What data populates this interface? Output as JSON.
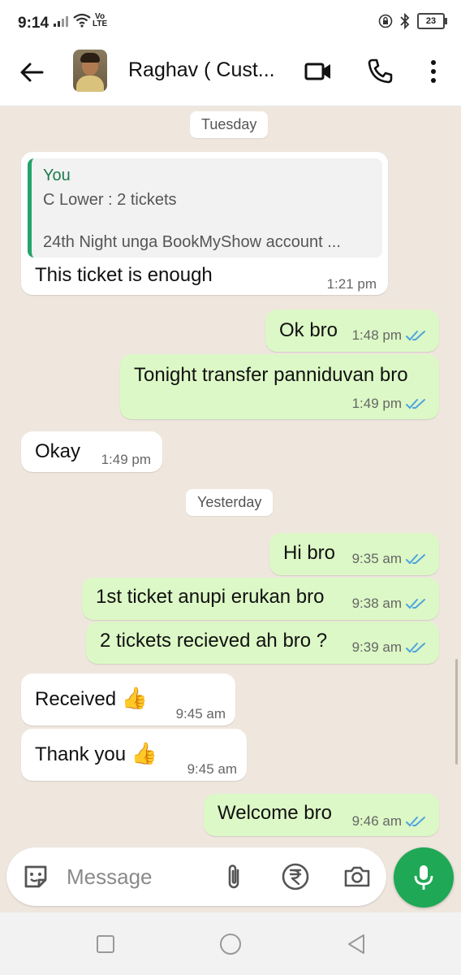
{
  "status_bar": {
    "time": "9:14",
    "network_label_top": "Vo",
    "network_label_bottom": "LTE",
    "battery_level": "23"
  },
  "header": {
    "contact_name": "Raghav ( Cust...",
    "icons": [
      "back-arrow-icon",
      "video-call-icon",
      "phone-icon",
      "more-vert-icon"
    ]
  },
  "chat": {
    "dates": {
      "tuesday": "Tuesday",
      "yesterday": "Yesterday"
    },
    "reply": {
      "quote_author": "You",
      "quote_line1": "C Lower : 2 tickets",
      "quote_line2": "24th Night unga BookMyShow account ...",
      "text": "This ticket is enough",
      "time": "1:21 pm"
    },
    "messages": [
      {
        "direction": "out",
        "text": "Ok bro",
        "time": "1:48 pm",
        "status": "read"
      },
      {
        "direction": "out",
        "text": "Tonight transfer panniduvan bro",
        "time": "1:49 pm",
        "status": "read"
      },
      {
        "direction": "in",
        "text": "Okay",
        "time": "1:49 pm"
      },
      {
        "direction": "out",
        "text": "Hi bro",
        "time": "9:35 am",
        "status": "read"
      },
      {
        "direction": "out",
        "text": "1st ticket anupi erukan bro",
        "time": "9:38 am",
        "status": "read"
      },
      {
        "direction": "out",
        "text": "2 tickets recieved ah bro ?",
        "time": "9:39 am",
        "status": "read"
      },
      {
        "direction": "in",
        "text": "Received",
        "emoji": "👍",
        "time": "9:45 am"
      },
      {
        "direction": "in",
        "text": "Thank you",
        "emoji": "👍",
        "time": "9:45 am"
      },
      {
        "direction": "out",
        "text": "Welcome bro",
        "time": "9:46 am",
        "status": "read"
      }
    ]
  },
  "input": {
    "placeholder": "Message",
    "icons": [
      "sticker-icon",
      "attach-icon",
      "rupee-icon",
      "camera-icon",
      "mic-icon"
    ]
  },
  "colors": {
    "outgoing_bubble": "#dcf8c6",
    "incoming_bubble": "#ffffff",
    "chat_background": "#efe7de",
    "read_ticks": "#4fa3e0",
    "mic_button": "#1fa855",
    "quote_bar": "#24a46a"
  }
}
